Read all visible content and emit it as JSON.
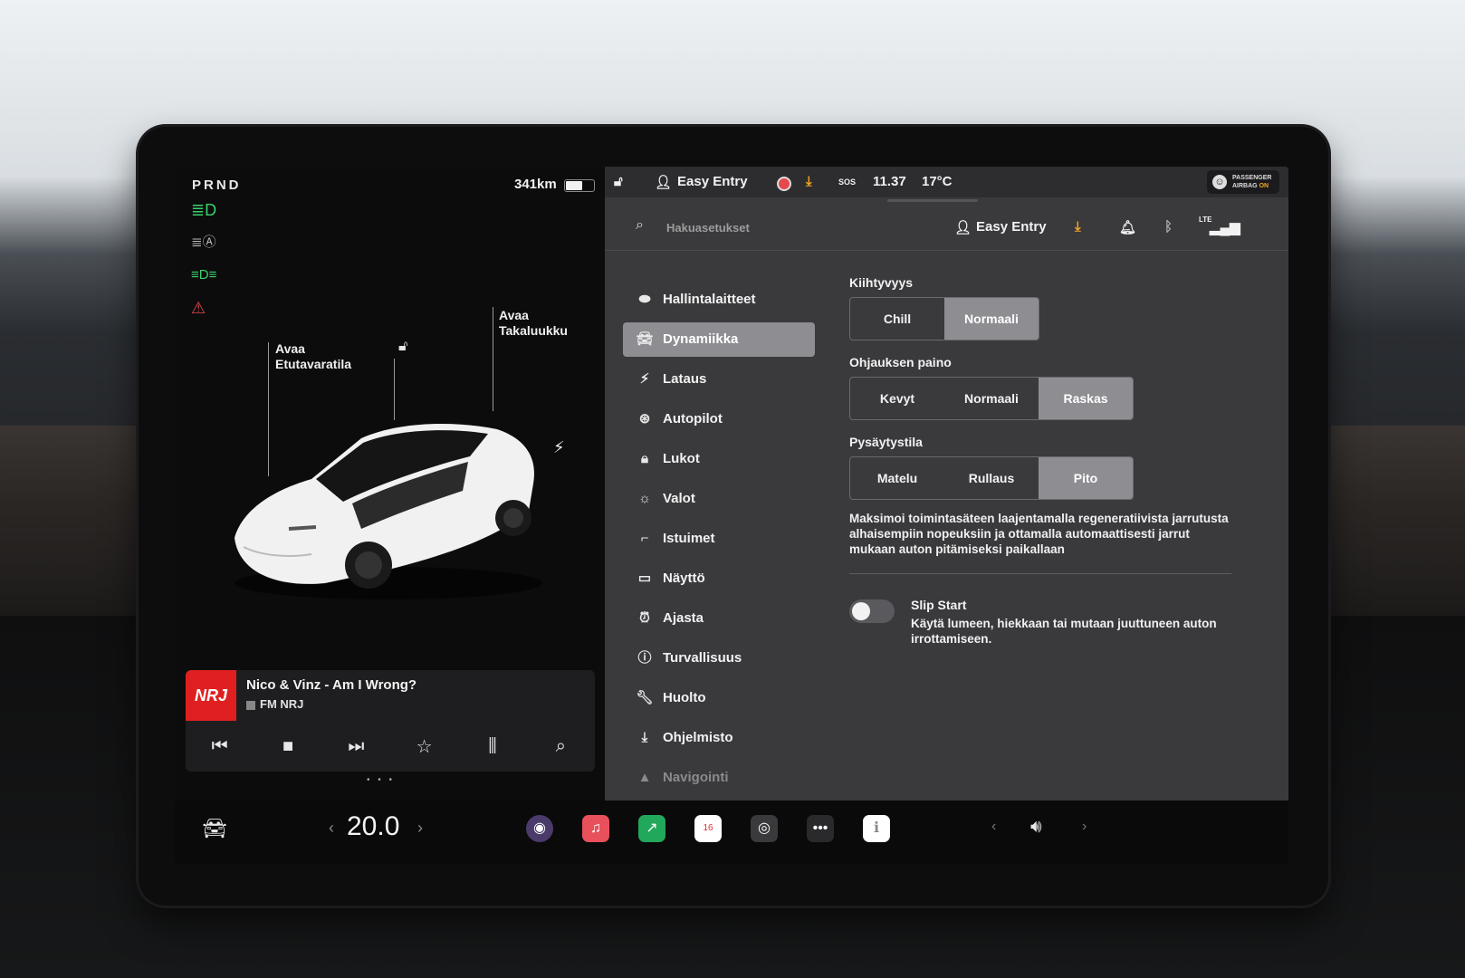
{
  "status": {
    "gear": "PRND",
    "range": "341km",
    "battery_level": 0.6
  },
  "left": {
    "callout_front_line1": "Avaa",
    "callout_front_line2": "Etutavaratila",
    "callout_rear_line1": "Avaa",
    "callout_rear_line2": "Takaluukku"
  },
  "media": {
    "logo_text": "NRJ",
    "title": "Nico & Vinz - Am I Wrong?",
    "station": "FM NRJ"
  },
  "topbar": {
    "profile": "Easy Entry",
    "time": "11.37",
    "temperature": "17°C",
    "sos": "SOS",
    "airbag_line1": "PASSENGER",
    "airbag_line2": "AIRBAG",
    "airbag_state": "ON"
  },
  "searchbar": {
    "placeholder": "Hakuasetukset",
    "profile": "Easy Entry",
    "network": "LTE"
  },
  "menu": {
    "items": [
      {
        "label": "Hallintalaitteet",
        "icon": "toggle-icon"
      },
      {
        "label": "Dynamiikka",
        "icon": "car-icon",
        "active": true
      },
      {
        "label": "Lataus",
        "icon": "bolt-icon"
      },
      {
        "label": "Autopilot",
        "icon": "steering-wheel-icon"
      },
      {
        "label": "Lukot",
        "icon": "lock-icon"
      },
      {
        "label": "Valot",
        "icon": "sun-icon"
      },
      {
        "label": "Istuimet",
        "icon": "seat-icon"
      },
      {
        "label": "Näyttö",
        "icon": "display-icon"
      },
      {
        "label": "Ajasta",
        "icon": "alarm-clock-icon"
      },
      {
        "label": "Turvallisuus",
        "icon": "info-circle-icon"
      },
      {
        "label": "Huolto",
        "icon": "wrench-icon"
      },
      {
        "label": "Ohjelmisto",
        "icon": "download-icon"
      },
      {
        "label": "Navigointi",
        "icon": "navigation-icon"
      }
    ]
  },
  "settings": {
    "acceleration": {
      "title": "Kiihtyvyys",
      "options": [
        "Chill",
        "Normaali"
      ],
      "selected": "Normaali"
    },
    "steering": {
      "title": "Ohjauksen paino",
      "options": [
        "Kevyt",
        "Normaali",
        "Raskas"
      ],
      "selected": "Raskas"
    },
    "stopping": {
      "title": "Pysäytystila",
      "options": [
        "Matelu",
        "Rullaus",
        "Pito"
      ],
      "selected": "Pito",
      "description": "Maksimoi toimintasäteen laajentamalla regeneratiivista jarrutusta alhaisempiin nopeuksiin ja ottamalla automaattisesti jarrut mukaan auton pitämiseksi paikallaan"
    },
    "slip_start": {
      "title": "Slip Start",
      "description": "Käytä lumeen, hiekkaan tai mutaan juuttuneen auton irrottamiseen.",
      "enabled": false
    }
  },
  "dock": {
    "temperature": "20.0",
    "calendar_day": "16",
    "colors": {
      "camera": "#4b3b6b",
      "music": "#e8505b",
      "stocks": "#22a85a",
      "calendar": "#ffffff",
      "dashcam": "#3a3a3c",
      "more": "#2a2a2c",
      "notes": "#ffffff"
    }
  }
}
